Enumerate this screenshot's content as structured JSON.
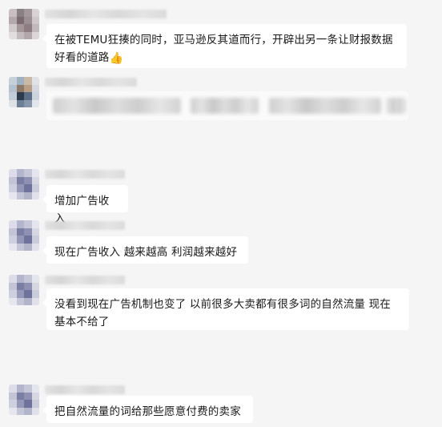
{
  "messages": [
    {
      "type": "text",
      "text_line1": "在被TEMU狂揍的同时，亚马逊反其道而行，开辟出另一条让财报数据",
      "text_line2": "好看的道路",
      "emoji": "👍"
    },
    {
      "type": "blurred"
    },
    {
      "type": "text",
      "text": "增加广告收入"
    },
    {
      "type": "text",
      "text": "现在广告收入 越来越高 利润越来越好"
    },
    {
      "type": "text",
      "text_line1": "没看到现在广告机制也变了  以前很多大卖都有很多词的自然流量 现在",
      "text_line2": "基本不给了"
    },
    {
      "type": "text",
      "text": "把自然流量的词给那些愿意付费的卖家"
    }
  ],
  "colors": {
    "background": "#f5f5f5",
    "bubble": "#ffffff",
    "text": "#1a1a1a"
  }
}
